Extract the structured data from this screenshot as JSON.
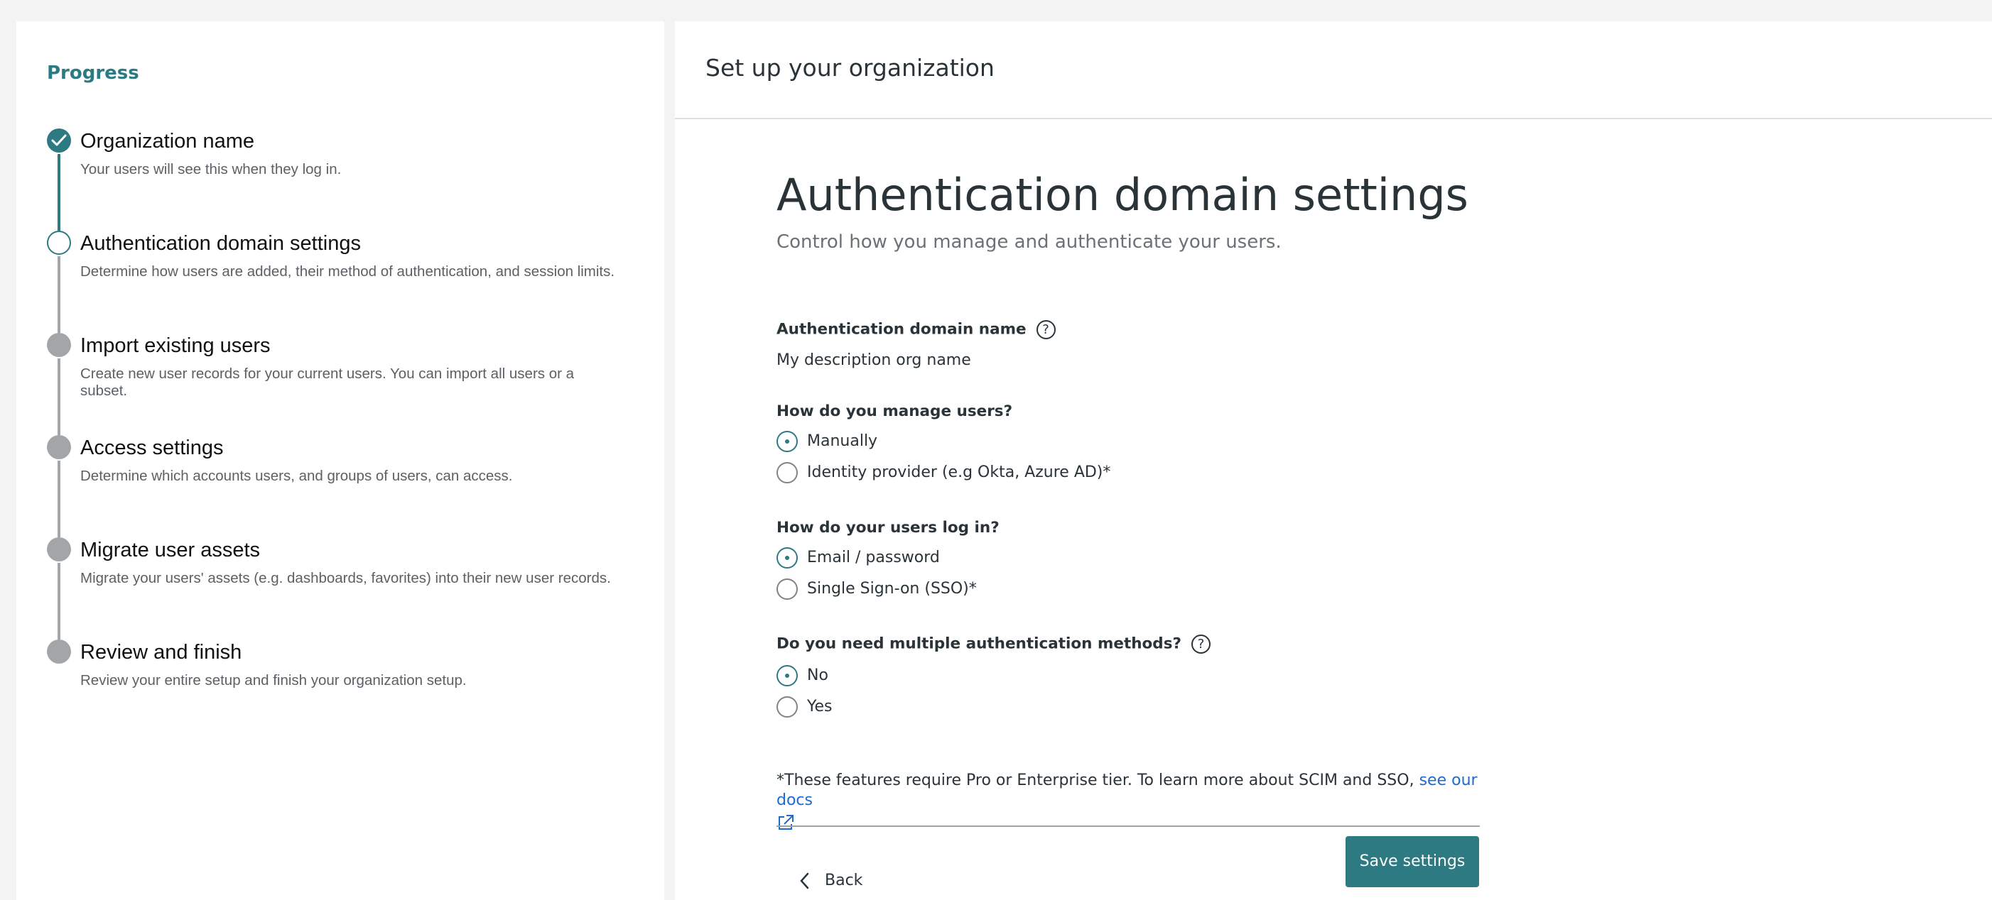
{
  "sidebar": {
    "progress_title": "Progress",
    "steps": [
      {
        "title": "Organization name",
        "desc": "Your users will see this when they log in.",
        "state": "done"
      },
      {
        "title": "Authentication domain settings",
        "desc": "Determine how users are added, their method of authentication, and session limits.",
        "state": "current"
      },
      {
        "title": "Import existing users",
        "desc": "Create new user records for your current users. You can import all users or a subset.",
        "state": "todo"
      },
      {
        "title": "Access settings",
        "desc": "Determine which accounts users, and groups of users, can access.",
        "state": "todo"
      },
      {
        "title": "Migrate user assets",
        "desc": "Migrate your users' assets (e.g. dashboards, favorites) into their new user records.",
        "state": "todo"
      },
      {
        "title": "Review and finish",
        "desc": "Review your entire setup and finish your organization setup.",
        "state": "todo"
      }
    ]
  },
  "header": {
    "title": "Set up your organization"
  },
  "form": {
    "heading": "Authentication domain settings",
    "subheading": "Control how you manage and authenticate your users.",
    "domain_name": {
      "label": "Authentication domain name",
      "value": "My description org name"
    },
    "manage_users": {
      "label": "How do you manage users?",
      "options": [
        "Manually",
        "Identity provider (e.g Okta, Azure AD)*"
      ],
      "selected": "Manually"
    },
    "login": {
      "label": "How do your users log in?",
      "options": [
        "Email / password",
        "Single Sign-on (SSO)*"
      ],
      "selected": "Email / password"
    },
    "multi_auth": {
      "label": "Do you need multiple authentication methods?",
      "options": [
        "No",
        "Yes"
      ],
      "selected": "No"
    },
    "footnote": "*These features require Pro or Enterprise tier. To learn more about SCIM and SSO,",
    "footnote_link": "see our docs",
    "back_label": "Back",
    "save_label": "Save settings"
  },
  "colors": {
    "accent": "#2e7a83",
    "link": "#1e6ad1",
    "inactive": "#a3a6a8"
  },
  "icons": [
    "check-icon",
    "help-icon",
    "external-link-icon",
    "chevron-left-icon"
  ]
}
